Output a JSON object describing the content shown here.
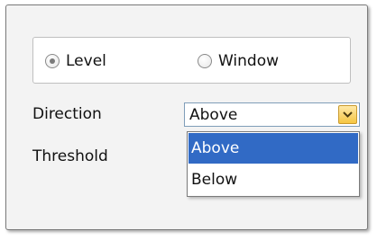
{
  "mode": {
    "options": [
      {
        "label": "Level",
        "checked": true
      },
      {
        "label": "Window",
        "checked": false
      }
    ]
  },
  "direction": {
    "label": "Direction",
    "value": "Above",
    "options": [
      "Above",
      "Below"
    ],
    "highlighted": "Above"
  },
  "threshold": {
    "label": "Threshold"
  },
  "icons": {
    "dropdown_arrow": "chevron-down-icon",
    "radio_selected": "radio-selected-icon",
    "radio_unselected": "radio-unselected-icon"
  },
  "colors": {
    "highlight": "#316ac5",
    "dropdown_button": "#f5c542",
    "panel_background": "#f3f3f3"
  }
}
